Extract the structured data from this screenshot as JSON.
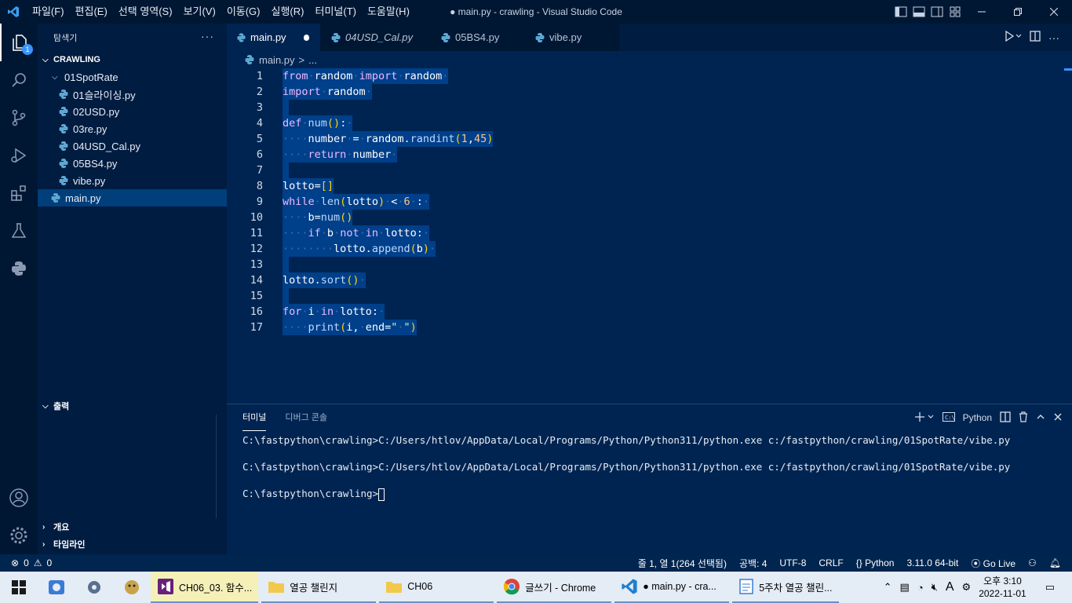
{
  "titlebar": {
    "menu": [
      "파일(F)",
      "편집(E)",
      "선택 영역(S)",
      "보기(V)",
      "이동(G)",
      "실행(R)",
      "터미널(T)",
      "도움말(H)"
    ],
    "title": "● main.py - crawling - Visual Studio Code"
  },
  "activity": {
    "explorer_badge": "1"
  },
  "sidebar": {
    "header": "탐색기",
    "more": "···",
    "section": "CRAWLING",
    "folder": "01SpotRate",
    "files": [
      "01슬라이싱.py",
      "02USD.py",
      "03re.py",
      "04USD_Cal.py",
      "05BS4.py",
      "vibe.py"
    ],
    "root_file": "main.py",
    "output_section": "출력",
    "outline": "개요",
    "timeline": "타임라인"
  },
  "tabs": [
    {
      "label": "main.py"
    },
    {
      "label": "04USD_Cal.py"
    },
    {
      "label": "05BS4.py"
    },
    {
      "label": "vibe.py"
    }
  ],
  "breadcrumb": {
    "file": "main.py",
    "sep": ">",
    "rest": "..."
  },
  "editor": {
    "line_numbers": [
      "1",
      "2",
      "3",
      "4",
      "5",
      "6",
      "7",
      "8",
      "9",
      "10",
      "11",
      "12",
      "13",
      "14",
      "15",
      "16",
      "17"
    ]
  },
  "panel": {
    "tabs": [
      "터미널",
      "디버그 콘솔"
    ],
    "shell": "Python",
    "lines": [
      "C:\\fastpython\\crawling>C:/Users/htlov/AppData/Local/Programs/Python/Python311/python.exe c:/fastpython/crawling/01SpotRate/vibe.py",
      "C:\\fastpython\\crawling>C:/Users/htlov/AppData/Local/Programs/Python/Python311/python.exe c:/fastpython/crawling/01SpotRate/vibe.py",
      "C:\\fastpython\\crawling>"
    ]
  },
  "status": {
    "errors": "0",
    "warnings": "0",
    "position": "줄 1, 열 1(264 선택됨)",
    "spaces": "공백: 4",
    "encoding": "UTF-8",
    "eol": "CRLF",
    "language": "Python",
    "interpreter": "3.11.0 64-bit",
    "golive": "Go Live"
  },
  "taskbar": {
    "apps": [
      "CH06_03. 함수...",
      "열공 챌린지",
      "CH06",
      "글쓰기 - Chrome",
      "● main.py - cra...",
      "5주차 열공 챌린..."
    ],
    "ime": "A",
    "time": "오후 3:10",
    "date": "2022-11-01"
  }
}
